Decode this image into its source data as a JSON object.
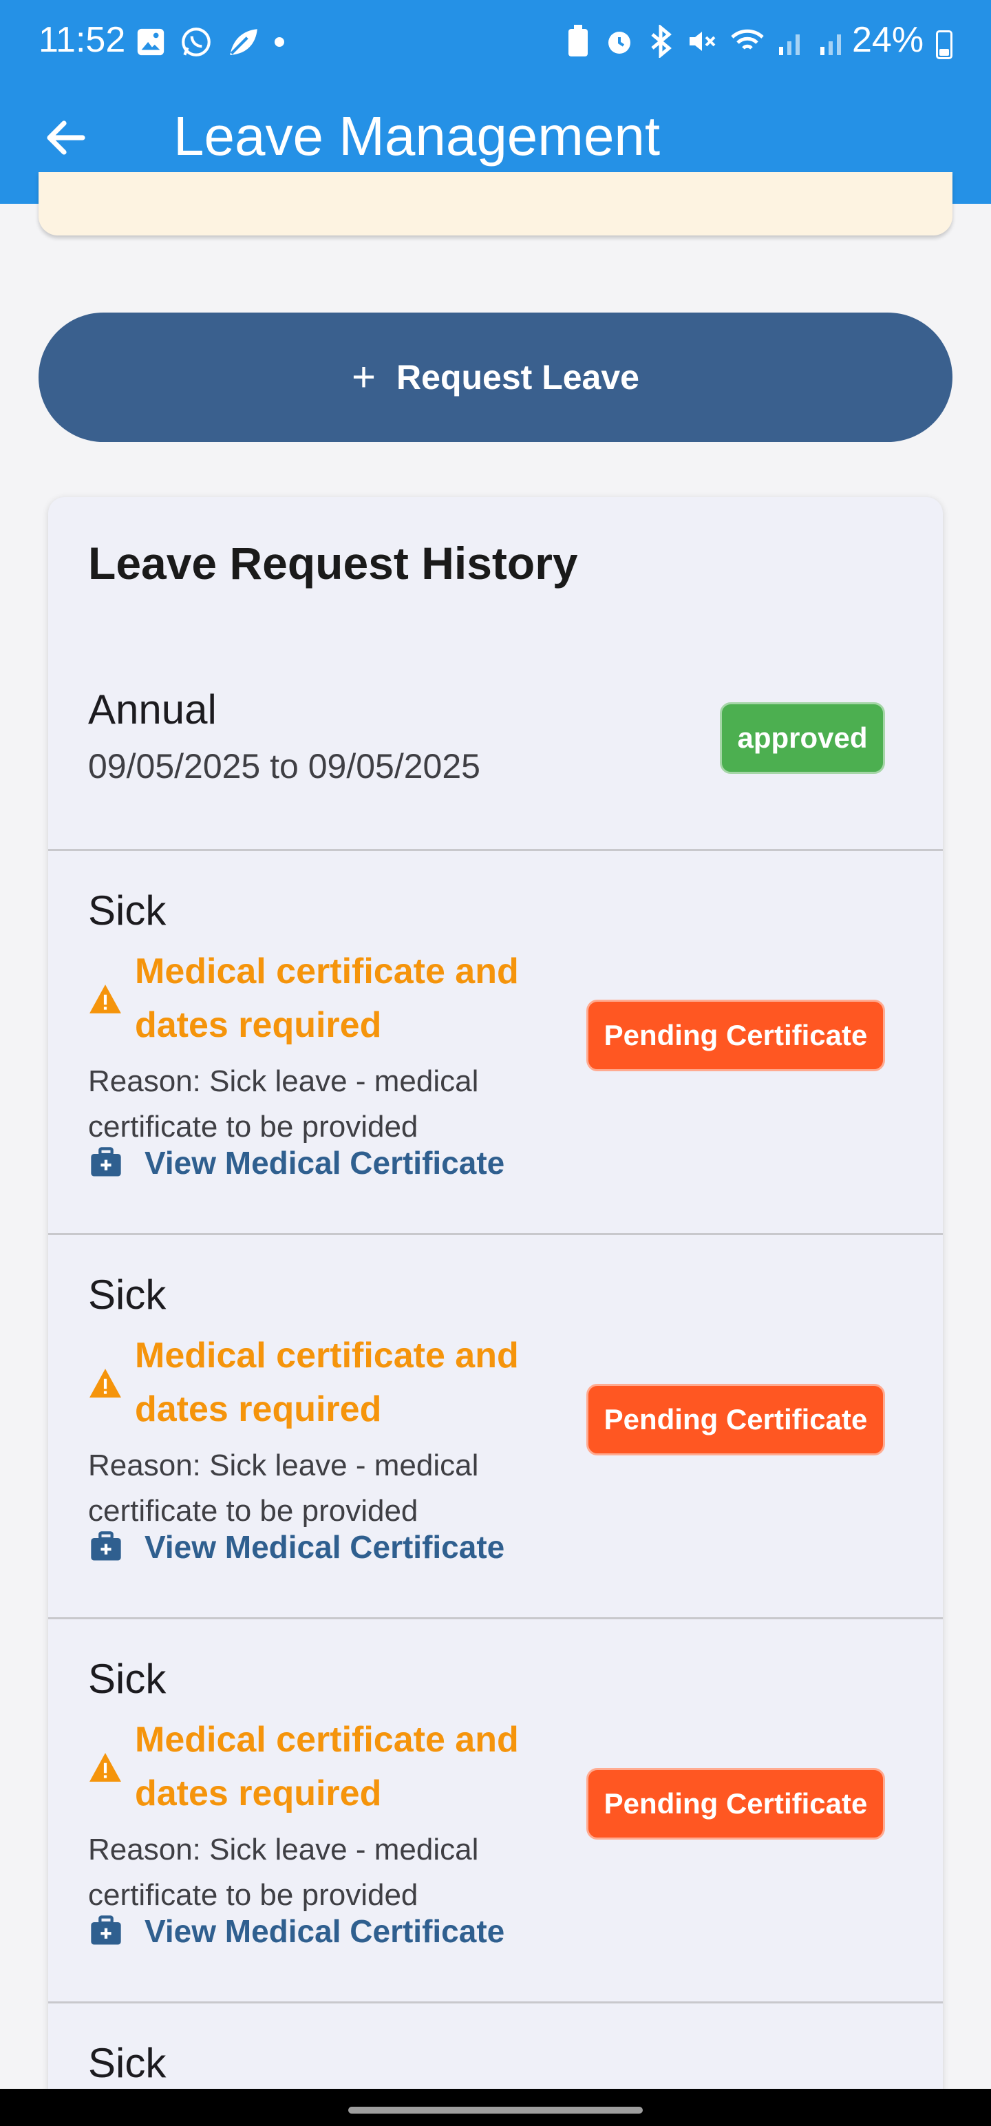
{
  "status_bar": {
    "time": "11:52",
    "battery": "24%"
  },
  "app_bar": {
    "title": "Leave Management"
  },
  "actions": {
    "request_leave": "Request Leave"
  },
  "history": {
    "title": "Leave Request History",
    "entries": [
      {
        "type": "Annual",
        "dates": "09/05/2025 to 09/05/2025",
        "status": "approved"
      },
      {
        "type": "Sick",
        "warning": "Medical certificate and dates required",
        "reason": "Reason: Sick leave - medical certificate to be provided",
        "link": "View Medical Certificate",
        "status": "Pending Certificate"
      },
      {
        "type": "Sick",
        "warning": "Medical certificate and dates required",
        "reason": "Reason: Sick leave - medical certificate to be provided",
        "link": "View Medical Certificate",
        "status": "Pending Certificate"
      },
      {
        "type": "Sick",
        "warning": "Medical certificate and dates required",
        "reason": "Reason: Sick leave - medical certificate to be provided",
        "link": "View Medical Certificate",
        "status": "Pending Certificate"
      },
      {
        "type": "Sick"
      }
    ]
  },
  "colors": {
    "app_bar": "#2591e6",
    "primary_button": "#3a608e",
    "approved": "#4caf50",
    "pending": "#ff5722",
    "warning": "#f5940b",
    "link": "#2f5f8f"
  },
  "icons": {
    "back": "arrow-left-icon",
    "add": "plus-icon",
    "warning": "warning-triangle-icon",
    "certificate": "medical-briefcase-icon"
  }
}
